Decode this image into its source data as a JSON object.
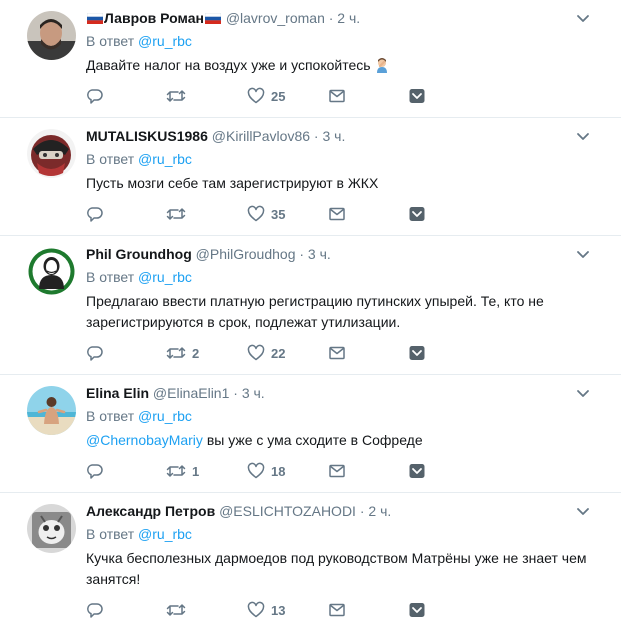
{
  "tweets": [
    {
      "name": "Лавров Роман",
      "handle": "@lavrov_roman",
      "time": "· 2 ч.",
      "reply_prefix": "В ответ",
      "reply_to": "@ru_rbc",
      "mention": "",
      "text": "Давайте налог на воздух уже и успокойтесь",
      "replies": "",
      "retweets": "",
      "likes": "25"
    },
    {
      "name": "MUTALISKUS1986",
      "handle": "@KirillPavlov86",
      "time": "· 3 ч.",
      "reply_prefix": "В ответ",
      "reply_to": "@ru_rbc",
      "mention": "",
      "text": "Пусть мозги себе там зарегистрируют в ЖКХ",
      "replies": "",
      "retweets": "",
      "likes": "35"
    },
    {
      "name": "Phil Groundhog",
      "handle": "@PhilGroudhog",
      "time": "· 3 ч.",
      "reply_prefix": "В ответ",
      "reply_to": "@ru_rbc",
      "mention": "",
      "text": "Предлагаю ввести платную регистрацию путинских упырей. Те, кто не зарегистрируются в срок, подлежат утилизации.",
      "replies": "",
      "retweets": "2",
      "likes": "22"
    },
    {
      "name": "Elina Elin",
      "handle": "@ElinaElin1",
      "time": "· 3 ч.",
      "reply_prefix": "В ответ",
      "reply_to": "@ru_rbc",
      "mention": "@ChernobayMariy",
      "text": "вы уже с ума сходите в Софреде",
      "replies": "",
      "retweets": "1",
      "likes": "18"
    },
    {
      "name": "Александр Петров",
      "handle": "@ESLICHTOZAHODI",
      "time": "· 2 ч.",
      "reply_prefix": "В ответ",
      "reply_to": "@ru_rbc",
      "mention": "",
      "text": "Кучка бесполезных дармоедов под руководством Матрёны уже не знает чем занятся!",
      "replies": "",
      "retweets": "",
      "likes": "13"
    }
  ],
  "colors": {
    "link": "#1da1f2",
    "secondary": "#657786",
    "text": "#14171a",
    "divider": "#e6ecf0"
  },
  "icons": [
    "reply-icon",
    "retweet-icon",
    "like-icon",
    "message-icon",
    "save-icon",
    "caret-down-icon",
    "flag-ru-icon",
    "facepalm-emoji-icon"
  ]
}
